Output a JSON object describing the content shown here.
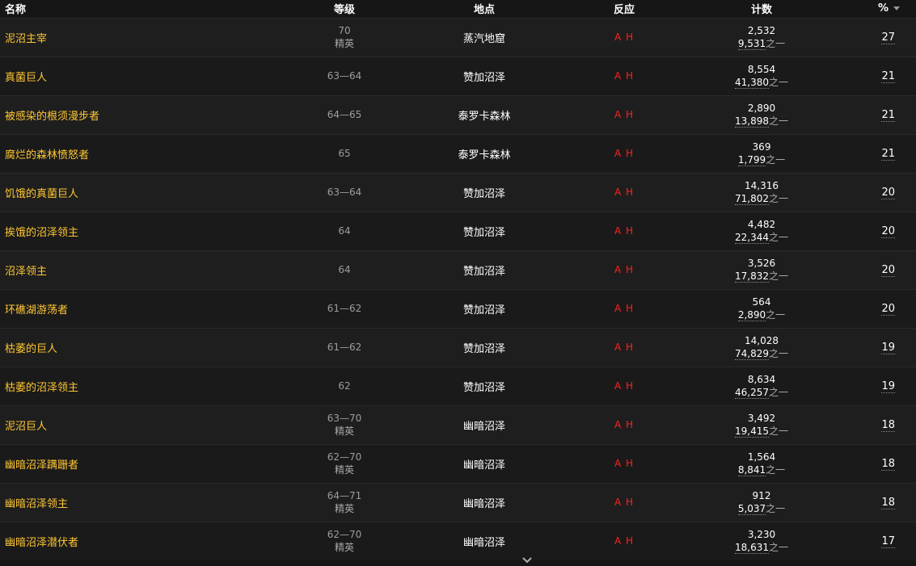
{
  "headers": {
    "name": "名称",
    "level": "等级",
    "location": "地点",
    "react": "反应",
    "count": "计数",
    "pct": "%"
  },
  "count_suffix": "之一",
  "rows": [
    {
      "name": "泥沼主宰",
      "level": "70",
      "elite": "精英",
      "location": "蒸汽地窟",
      "react": "A H",
      "count": "2,532",
      "total": "9,531",
      "pct": "27"
    },
    {
      "name": "真菌巨人",
      "level": "63—64",
      "elite": "",
      "location": "赞加沼泽",
      "react": "A H",
      "count": "8,554",
      "total": "41,380",
      "pct": "21"
    },
    {
      "name": "被感染的根须漫步者",
      "level": "64—65",
      "elite": "",
      "location": "泰罗卡森林",
      "react": "A H",
      "count": "2,890",
      "total": "13,898",
      "pct": "21"
    },
    {
      "name": "腐烂的森林愤怒者",
      "level": "65",
      "elite": "",
      "location": "泰罗卡森林",
      "react": "A H",
      "count": "369",
      "total": "1,799",
      "pct": "21"
    },
    {
      "name": "饥饿的真菌巨人",
      "level": "63—64",
      "elite": "",
      "location": "赞加沼泽",
      "react": "A H",
      "count": "14,316",
      "total": "71,802",
      "pct": "20"
    },
    {
      "name": "挨饿的沼泽领主",
      "level": "64",
      "elite": "",
      "location": "赞加沼泽",
      "react": "A H",
      "count": "4,482",
      "total": "22,344",
      "pct": "20"
    },
    {
      "name": "沼泽领主",
      "level": "64",
      "elite": "",
      "location": "赞加沼泽",
      "react": "A H",
      "count": "3,526",
      "total": "17,832",
      "pct": "20"
    },
    {
      "name": "环礁湖游荡者",
      "level": "61—62",
      "elite": "",
      "location": "赞加沼泽",
      "react": "A H",
      "count": "564",
      "total": "2,890",
      "pct": "20"
    },
    {
      "name": "枯萎的巨人",
      "level": "61—62",
      "elite": "",
      "location": "赞加沼泽",
      "react": "A H",
      "count": "14,028",
      "total": "74,829",
      "pct": "19"
    },
    {
      "name": "枯萎的沼泽领主",
      "level": "62",
      "elite": "",
      "location": "赞加沼泽",
      "react": "A H",
      "count": "8,634",
      "total": "46,257",
      "pct": "19"
    },
    {
      "name": "泥沼巨人",
      "level": "63—70",
      "elite": "精英",
      "location": "幽暗沼泽",
      "react": "A H",
      "count": "3,492",
      "total": "19,415",
      "pct": "18"
    },
    {
      "name": "幽暗沼泽蹒跚者",
      "level": "62—70",
      "elite": "精英",
      "location": "幽暗沼泽",
      "react": "A H",
      "count": "1,564",
      "total": "8,841",
      "pct": "18"
    },
    {
      "name": "幽暗沼泽领主",
      "level": "64—71",
      "elite": "精英",
      "location": "幽暗沼泽",
      "react": "A H",
      "count": "912",
      "total": "5,037",
      "pct": "18"
    },
    {
      "name": "幽暗沼泽潜伏者",
      "level": "62—70",
      "elite": "精英",
      "location": "幽暗沼泽",
      "react": "A H",
      "count": "3,230",
      "total": "18,631",
      "pct": "17"
    }
  ],
  "icons": {
    "sort": "sort-desc-icon",
    "more": "chevron-down-icon"
  }
}
